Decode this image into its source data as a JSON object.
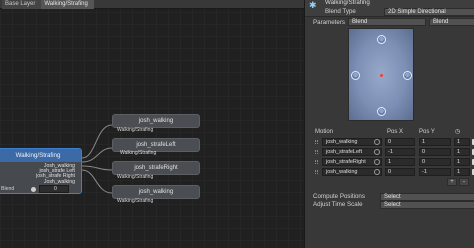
{
  "breadcrumbs": [
    "Base Layer",
    "Walking/Strafing"
  ],
  "graph": {
    "states": [
      {
        "title": "josh_walking",
        "sub": "Walking/Strafing"
      },
      {
        "title": "josh_strafeLeft",
        "sub": "Walking/Strafing"
      },
      {
        "title": "josh_strafeRight",
        "sub": "Walking/Strafing"
      },
      {
        "title": "josh_walking",
        "sub": "Walking/Strafing"
      }
    ],
    "tree": {
      "title": "Walking/Strafing",
      "motions": [
        "Josh_walking",
        "josh_strafe Left",
        "josh_strafe Right",
        "Josh_walking"
      ],
      "blend_label": "Blend",
      "blend_value": "0"
    }
  },
  "inspector": {
    "title": "Walking/Strafing",
    "blend_type_label": "Blend Type",
    "blend_type_value": "2D Simple Directional",
    "parameters_label": "Parameters",
    "param_x": "Blend",
    "param_y": "Blend",
    "motion_headers": {
      "motion": "Motion",
      "pos_x": "Pos X",
      "pos_y": "Pos Y"
    },
    "motions": [
      {
        "clip": "josh_walking",
        "pos_x": "0",
        "pos_y": "1",
        "speed": "1"
      },
      {
        "clip": "josh_strafeLeft",
        "pos_x": "-1",
        "pos_y": "0",
        "speed": "1"
      },
      {
        "clip": "josh_strafeRight",
        "pos_x": "1",
        "pos_y": "0",
        "speed": "1"
      },
      {
        "clip": "josh_walking",
        "pos_x": "0",
        "pos_y": "-1",
        "speed": "1"
      }
    ],
    "plus": "+",
    "minus": "-",
    "compute_positions_label": "Compute Positions",
    "compute_positions_value": "Select",
    "adjust_time_scale_label": "Adjust Time Scale",
    "adjust_time_scale_value": "Select"
  },
  "colors": {
    "graph_bg": "#202020",
    "node": "#4a4d51",
    "tree_header": "#3b6aa6",
    "blend_space": "#8a9cc0",
    "blend_center": "#ff3a2e"
  }
}
